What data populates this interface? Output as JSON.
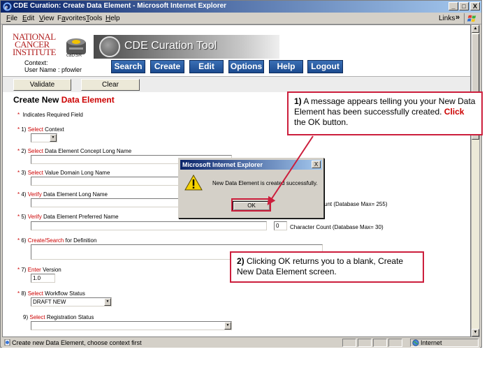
{
  "window": {
    "title": "CDE Curation: Create Data Element - Microsoft Internet Explorer",
    "min_glyph": "_",
    "max_glyph": "□",
    "close_glyph": "X"
  },
  "menu": {
    "items": [
      {
        "underline": "F",
        "rest": "ile"
      },
      {
        "underline": "E",
        "rest": "dit"
      },
      {
        "underline": "V",
        "rest": "iew"
      },
      {
        "underline": "",
        "rest": "Favorites",
        "full": "F",
        "tail": "a",
        "after": "vorites"
      },
      {
        "underline": "T",
        "rest": "ools"
      },
      {
        "underline": "H",
        "rest": "elp"
      }
    ],
    "links": "Links",
    "links_chevron": "»"
  },
  "header": {
    "nci_line1": "NATIONAL",
    "nci_line2": "CANCER",
    "nci_line3": "INSTITUTE",
    "cadsr": "caDSR",
    "tool_title": "CDE Curation Tool",
    "context_label": "Context:",
    "user_label": "User Name : pfowler",
    "nav": [
      "Search",
      "Create",
      "Edit",
      "Options",
      "Help",
      "Logout"
    ]
  },
  "actions": {
    "validate": "Validate",
    "clear": "Clear"
  },
  "form": {
    "title_black": "Create New ",
    "title_red": "Data Element",
    "required_note": "Indicates Required Field",
    "star": "*",
    "fields": [
      {
        "num": "1)",
        "verb": "Select",
        "label": " Context"
      },
      {
        "num": "2)",
        "verb": "Select",
        "label": " Data Element Concept Long Name"
      },
      {
        "num": "3)",
        "verb": "Select",
        "label": " Value Domain Long Name"
      },
      {
        "num": "4)",
        "verb": "Verify",
        "label": " Data Element Long Name"
      },
      {
        "num": "5)",
        "verb": "Verify",
        "label": " Data Element Preferred Name"
      },
      {
        "num": "6)",
        "verb": "Create/Search",
        "label": " for Definition"
      },
      {
        "num": "7)",
        "verb": "Enter",
        "label": " Version"
      },
      {
        "num": "8)",
        "verb": "Select",
        "label": " Workflow Status"
      },
      {
        "num": "9)",
        "verb": "Select",
        "label": " Registration Status"
      }
    ],
    "long_name_count_tail": "unt  (Database Max= 255)",
    "preferred_count_value": "0",
    "preferred_count_label": "Character Count  (Database Max= 30)",
    "version_value": "1.0",
    "workflow_value": "DRAFT NEW"
  },
  "dialog": {
    "title": "Microsoft Internet Explorer",
    "message": "New Data Element is created successfully.",
    "ok": "OK",
    "close": "X"
  },
  "callouts": {
    "c1_num": "1)",
    "c1_text_a": " A message appears telling you your New Data Element has been successfully created. ",
    "c1_click": "Click",
    "c1_text_b": " the OK button.",
    "c2_num": "2)",
    "c2_text": " Clicking OK returns you to a blank, Create New Data Element screen."
  },
  "status": {
    "text": "Create new Data Element, choose context first",
    "zone": "Internet"
  },
  "colors": {
    "accent_red": "#cc0000",
    "callout_border": "#cc1e3c",
    "nav_blue": "#1c4b8f"
  }
}
